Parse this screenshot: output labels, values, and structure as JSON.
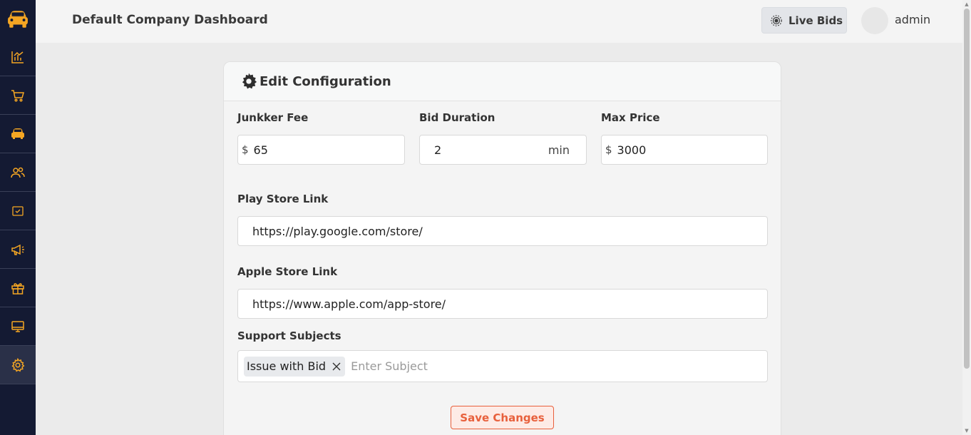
{
  "header": {
    "title": "Default Company Dashboard",
    "live_bids_label": "Live Bids",
    "username": "admin"
  },
  "sidebar": {
    "items": [
      {
        "icon": "car-logo-icon"
      },
      {
        "icon": "analytics-icon"
      },
      {
        "icon": "cart-icon"
      },
      {
        "icon": "car-icon"
      },
      {
        "icon": "users-icon"
      },
      {
        "icon": "checklist-icon"
      },
      {
        "icon": "megaphone-icon"
      },
      {
        "icon": "gift-icon"
      },
      {
        "icon": "monitor-icon"
      },
      {
        "icon": "gear-icon",
        "active": true
      }
    ],
    "accent_color": "#f5a623",
    "background_color": "#141a33"
  },
  "card": {
    "title": "Edit Configuration",
    "junkker_fee": {
      "label": "Junkker Fee",
      "prefix": "$",
      "value": "65"
    },
    "bid_duration": {
      "label": "Bid Duration",
      "value": "2",
      "suffix": "min"
    },
    "max_price": {
      "label": "Max Price",
      "prefix": "$",
      "value": "3000"
    },
    "play_store": {
      "label": "Play Store Link",
      "value": "https://play.google.com/store/"
    },
    "apple_store": {
      "label": "Apple Store Link",
      "value": "https://www.apple.com/app-store/"
    },
    "support_subjects": {
      "label": "Support Subjects",
      "chips": [
        "Issue with Bid"
      ],
      "placeholder": "Enter Subject"
    },
    "save_label": "Save Changes",
    "save_color": "#e8603c"
  }
}
